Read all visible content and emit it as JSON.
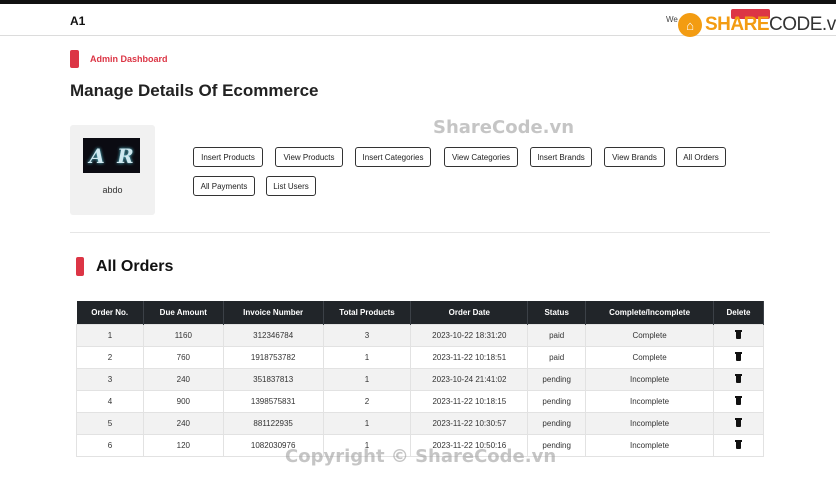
{
  "navbar": {
    "brand": "A1",
    "welcome": "We"
  },
  "watermark_logo": {
    "share": "SHARE",
    "code": "CODE.vn"
  },
  "admin": {
    "label": "Admin Dashboard"
  },
  "page_title": "Manage Details Of Ecommerce",
  "profile": {
    "name": "abdo",
    "image_letters": [
      "A",
      "R"
    ]
  },
  "buttons": {
    "insert_products": "Insert Products",
    "view_products": "View Products",
    "insert_categories": "Insert Categories",
    "view_categories": "View Categories",
    "insert_brands": "Insert Brands",
    "view_brands": "View Brands",
    "all_orders": "All Orders",
    "all_payments": "All Payments",
    "list_users": "List Users"
  },
  "section_title": "All Orders",
  "table": {
    "headers": [
      "Order No.",
      "Due Amount",
      "Invoice Number",
      "Total Products",
      "Order Date",
      "Status",
      "Complete/Incomplete",
      "Delete"
    ],
    "rows": [
      [
        "1",
        "1160",
        "312346784",
        "3",
        "2023-10-22 18:31:20",
        "paid",
        "Complete"
      ],
      [
        "2",
        "760",
        "1918753782",
        "1",
        "2023-11-22 10:18:51",
        "paid",
        "Complete"
      ],
      [
        "3",
        "240",
        "351837813",
        "1",
        "2023-10-24 21:41:02",
        "pending",
        "Incomplete"
      ],
      [
        "4",
        "900",
        "1398575831",
        "2",
        "2023-11-22 10:18:15",
        "pending",
        "Incomplete"
      ],
      [
        "5",
        "240",
        "881122935",
        "1",
        "2023-11-22 10:30:57",
        "pending",
        "Incomplete"
      ],
      [
        "6",
        "120",
        "1082030976",
        "1",
        "2023-11-22 10:50:16",
        "pending",
        "Incomplete"
      ]
    ]
  },
  "watermarks": {
    "center": "ShareCode.vn",
    "bottom": "Copyright © ShareCode.vn"
  },
  "colors": {
    "accent": "#dc3545",
    "table_header": "#212529",
    "logo_orange": "#f39c12"
  }
}
